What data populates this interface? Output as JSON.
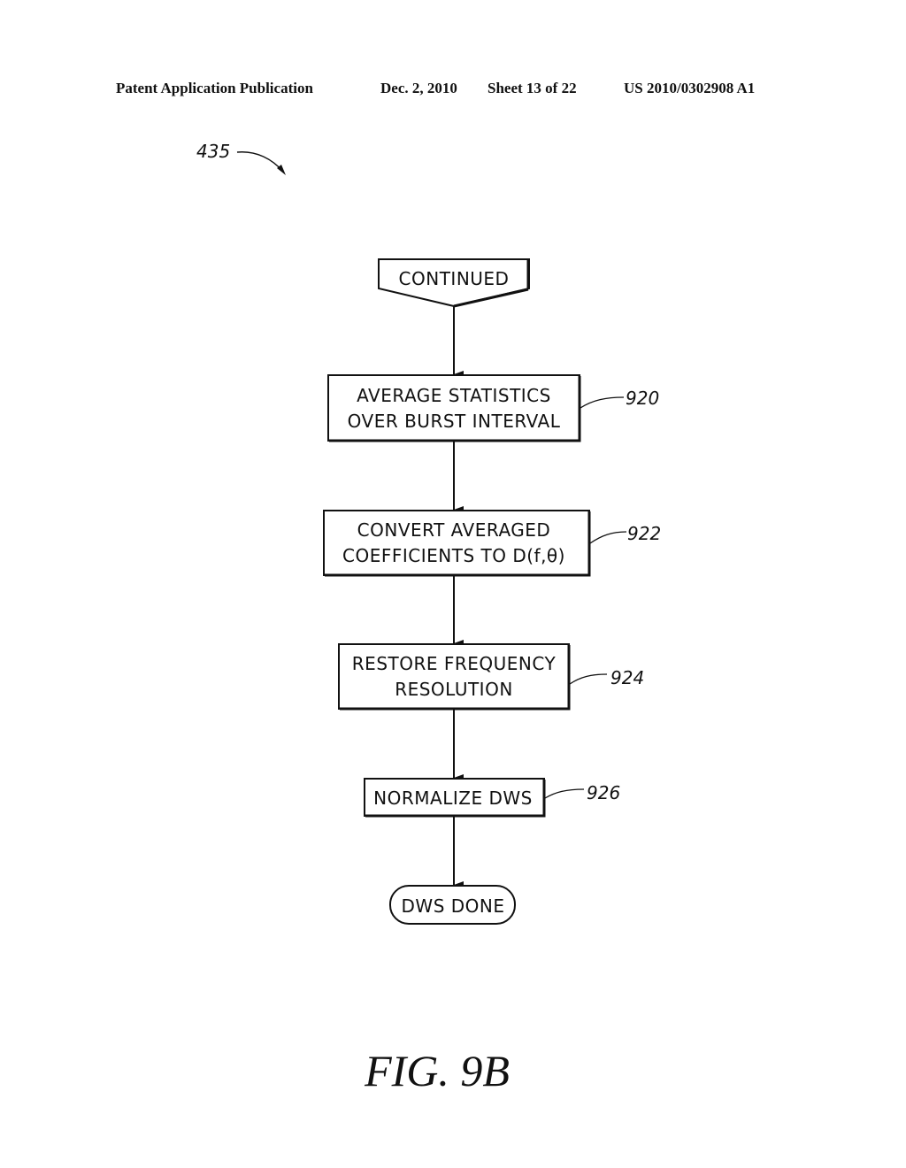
{
  "header": {
    "publication": "Patent Application Publication",
    "date": "Dec. 2, 2010",
    "sheet": "Sheet 13 of 22",
    "number": "US 2010/0302908 A1"
  },
  "diagram": {
    "ref_main": "435",
    "start": {
      "label": "CONTINUED",
      "shape": "off-page-connector"
    },
    "steps": [
      {
        "ref": "920",
        "lines": [
          "AVERAGE STATISTICS",
          "OVER BURST INTERVAL"
        ]
      },
      {
        "ref": "922",
        "lines": [
          "CONVERT AVERAGED",
          "COEFFICIENTS TO D(f,θ)"
        ]
      },
      {
        "ref": "924",
        "lines": [
          "RESTORE FREQUENCY",
          "RESOLUTION"
        ]
      },
      {
        "ref": "926",
        "lines": [
          "NORMALIZE DWS"
        ]
      }
    ],
    "end": {
      "label": "DWS DONE",
      "shape": "terminator"
    },
    "edges": [
      [
        "CONTINUED",
        "920"
      ],
      [
        "920",
        "922"
      ],
      [
        "922",
        "924"
      ],
      [
        "924",
        "926"
      ],
      [
        "926",
        "DWS DONE"
      ]
    ]
  },
  "figure_label": "FIG. 9B"
}
